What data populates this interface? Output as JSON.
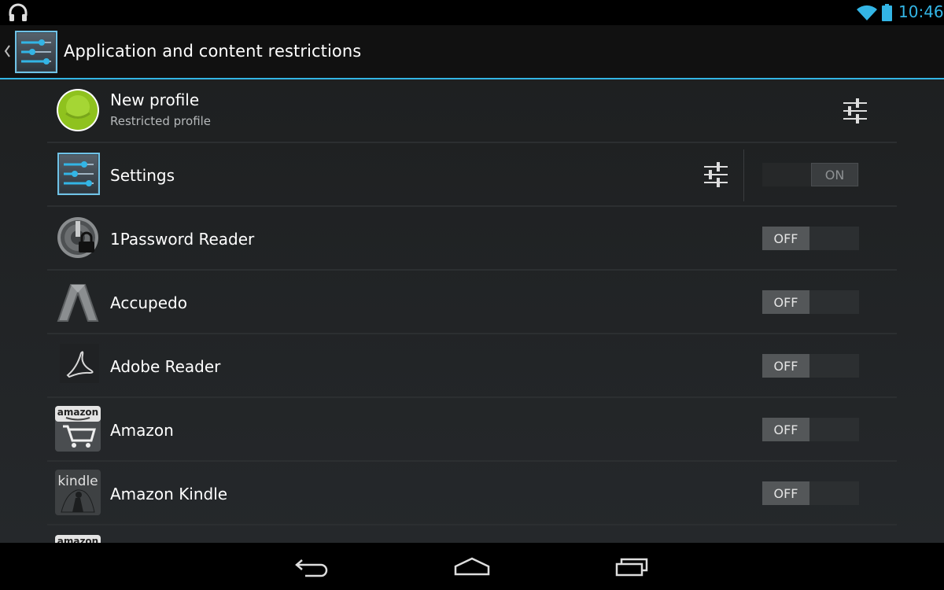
{
  "status_bar": {
    "time": "10:46",
    "icons": [
      "headphones-icon",
      "wifi-icon",
      "battery-icon"
    ],
    "accent_color": "#33b5e5"
  },
  "action_bar": {
    "title": "Application and content restrictions",
    "icon": "settings-app-icon"
  },
  "profile": {
    "name": "New profile",
    "subtitle": "Restricted profile",
    "icon": "profile-avatar",
    "action_icon": "sliders-icon"
  },
  "apps": [
    {
      "name": "Settings",
      "icon": "settings-app-icon",
      "has_settings": true,
      "toggle": "ON",
      "enabled": true
    },
    {
      "name": "1Password Reader",
      "icon": "1password-app-icon",
      "toggle": "OFF",
      "enabled": false
    },
    {
      "name": "Accupedo",
      "icon": "accupedo-app-icon",
      "toggle": "OFF",
      "enabled": false
    },
    {
      "name": "Adobe Reader",
      "icon": "adobe-reader-app-icon",
      "toggle": "OFF",
      "enabled": false
    },
    {
      "name": "Amazon",
      "icon": "amazon-app-icon",
      "icon_text": "amazon",
      "toggle": "OFF",
      "enabled": false
    },
    {
      "name": "Amazon Kindle",
      "icon": "kindle-app-icon",
      "icon_text": "kindle",
      "toggle": "OFF",
      "enabled": false
    }
  ],
  "partial_item_icon_text": "amazon",
  "nav_bar": {
    "buttons": [
      "back-icon",
      "home-icon",
      "recents-icon"
    ]
  }
}
